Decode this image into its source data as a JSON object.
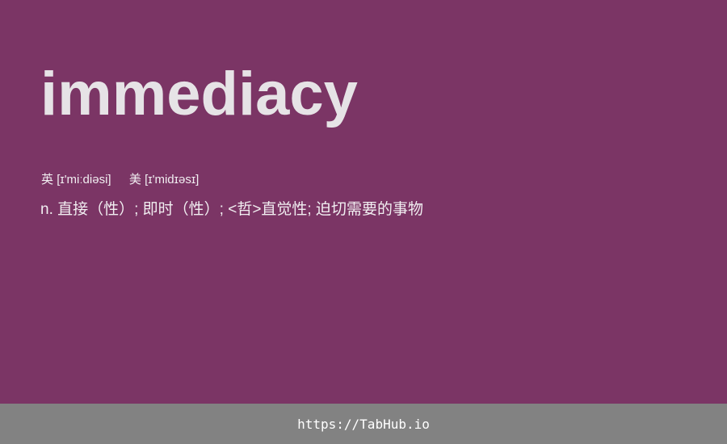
{
  "entry": {
    "word": "immediacy",
    "phonetics": {
      "uk_label": "英",
      "uk_ipa": "[ɪ'miːdiəsi]",
      "us_label": "美",
      "us_ipa": "[ɪ'midɪəsɪ]"
    },
    "definition": "n. 直接（性）; 即时（性）; <哲>直觉性; 迫切需要的事物"
  },
  "footer": {
    "link_text": "https://TabHub.io"
  },
  "colors": {
    "background": "#7b3565",
    "footer_background": "#828282",
    "word_text": "#e6e3e6",
    "body_text": "#f1eef1"
  }
}
